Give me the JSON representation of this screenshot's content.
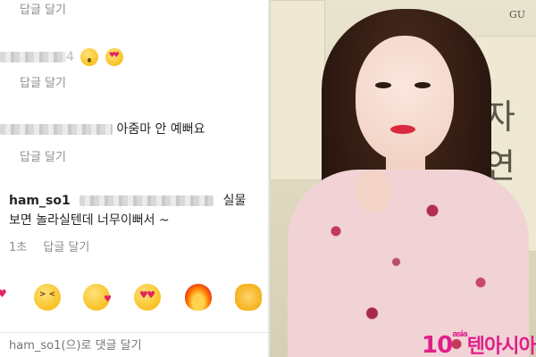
{
  "comments": {
    "reply_label_1": "답글 달기",
    "reply_label_2": "답글 달기",
    "reply_label_3": "답글 달기",
    "blurred_suffix": "4",
    "comment_text_2": "아줌마 안 예뻐요",
    "main": {
      "username": "ham_so1",
      "text_line1_end": "실물",
      "text_line2": "보면 놀라실텐데 너무이뻐서 ~",
      "time": "1초",
      "reply_label": "답글 달기"
    }
  },
  "reactions": [
    "heart",
    "laughing",
    "kissing",
    "heart-eyes",
    "fire",
    "clapping"
  ],
  "input": {
    "placeholder": "ham_so1(으)로 댓글 달기"
  },
  "photo": {
    "backdrop_text": "자연",
    "backdrop_small": "GU",
    "watermark_number": "10",
    "watermark_small": "asia",
    "watermark_text": "텐아시아"
  },
  "colors": {
    "text": "#262626",
    "muted": "#8e8e8e",
    "watermark": "#e0208a"
  }
}
